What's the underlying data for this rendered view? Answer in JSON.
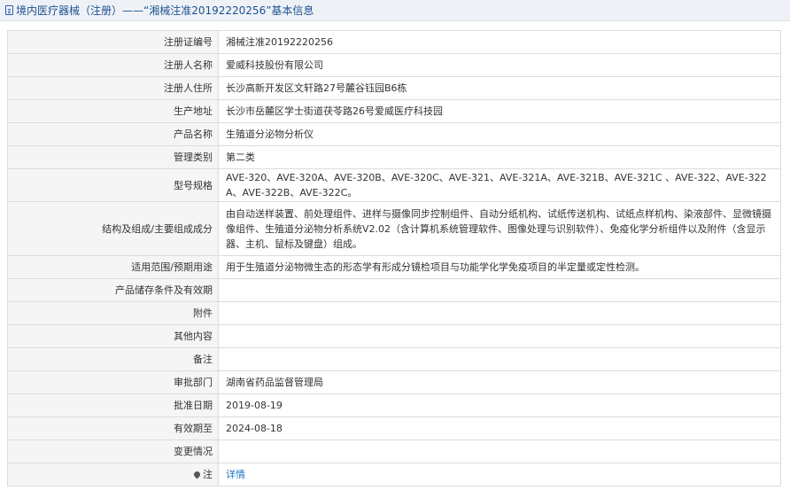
{
  "header": {
    "title": "境内医疗器械（注册）——“湘械注准20192220256”基本信息"
  },
  "rows": [
    {
      "label": "注册证编号",
      "value": "湘械注准20192220256"
    },
    {
      "label": "注册人名称",
      "value": "爱威科技股份有限公司"
    },
    {
      "label": "注册人住所",
      "value": "长沙高新开发区文轩路27号麓谷钰园B6栋"
    },
    {
      "label": "生产地址",
      "value": "长沙市岳麓区学士街道茯苓路26号爱威医疗科技园"
    },
    {
      "label": "产品名称",
      "value": "生殖道分泌物分析仪"
    },
    {
      "label": "管理类别",
      "value": "第二类"
    },
    {
      "label": "型号规格",
      "value": "AVE-320、AVE-320A、AVE-320B、AVE-320C、AVE-321、AVE-321A、AVE-321B、AVE-321C 、AVE-322、AVE-322A、AVE-322B、AVE-322C。"
    },
    {
      "label": "结构及组成/主要组成成分",
      "value": "由自动送样装置、前处理组件、进样与摄像同步控制组件、自动分纸机构、试纸传送机构、试纸点样机构、染液部件、显微镜摄像组件、生殖道分泌物分析系统V2.02（含计算机系统管理软件、图像处理与识别软件）、免疫化学分析组件以及附件（含显示器、主机、鼠标及键盘）组成。"
    },
    {
      "label": "适用范围/预期用途",
      "value": "用于生殖道分泌物微生态的形态学有形成分镜检项目与功能学化学免疫项目的半定量或定性检测。"
    },
    {
      "label": "产品储存条件及有效期",
      "value": ""
    },
    {
      "label": "附件",
      "value": ""
    },
    {
      "label": "其他内容",
      "value": ""
    },
    {
      "label": "备注",
      "value": ""
    },
    {
      "label": "审批部门",
      "value": "湖南省药品监督管理局"
    },
    {
      "label": "批准日期",
      "value": "2019-08-19"
    },
    {
      "label": "有效期至",
      "value": "2024-08-18"
    },
    {
      "label": "变更情况",
      "value": ""
    },
    {
      "label": "注",
      "value": "详情"
    }
  ]
}
